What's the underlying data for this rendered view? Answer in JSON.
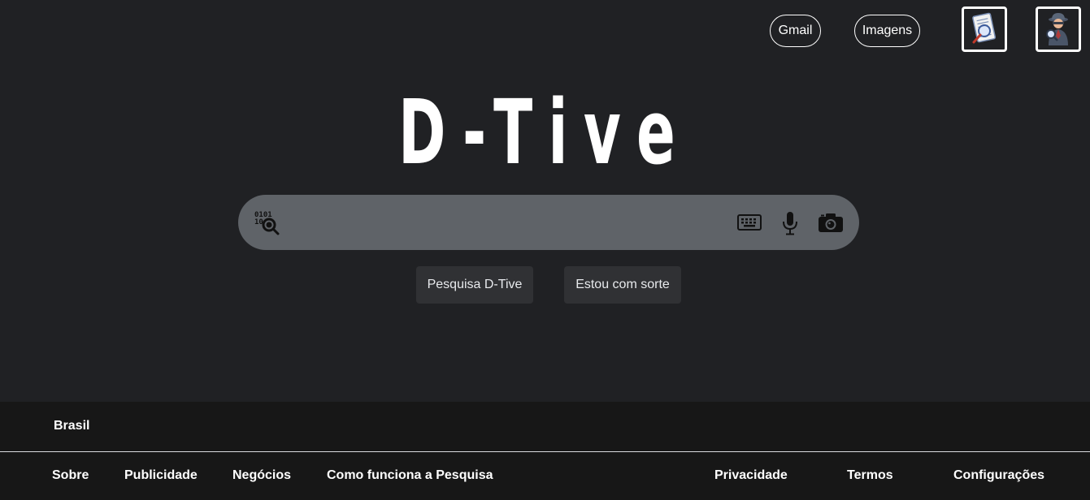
{
  "header": {
    "gmail_label": "Gmail",
    "images_label": "Imagens"
  },
  "logo": {
    "text": "D-Tive"
  },
  "search": {
    "value": "",
    "placeholder": "",
    "icons": [
      "binary-search-icon",
      "keyboard-icon",
      "microphone-icon",
      "camera-icon"
    ]
  },
  "buttons": {
    "search_label": "Pesquisa D-Tive",
    "lucky_label": "Estou com sorte"
  },
  "footer": {
    "country": "Brasil",
    "left_links": [
      "Sobre",
      "Publicidade",
      "Negócios",
      "Como funciona a Pesquisa"
    ],
    "right_links": [
      "Privacidade",
      "Termos",
      "Configurações"
    ]
  },
  "colors": {
    "background": "#202124",
    "search_bar": "#5f6368",
    "button": "#303134",
    "footer": "#171717"
  }
}
